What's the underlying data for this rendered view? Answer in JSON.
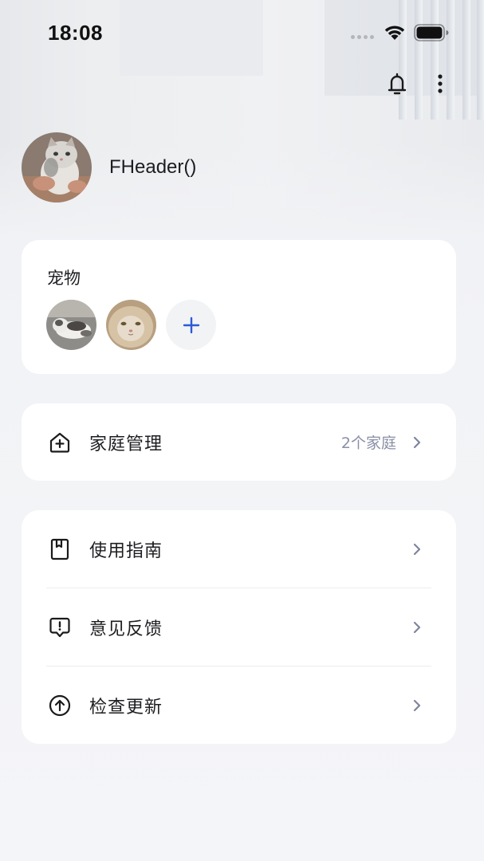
{
  "status_bar": {
    "time": "18:08"
  },
  "header": {
    "notification_icon": "bell-icon",
    "more_icon": "more-vertical-icon"
  },
  "profile": {
    "username": "FHeader()"
  },
  "pets": {
    "title": "宠物",
    "items": [
      "cat-photo-1",
      "cat-photo-2"
    ],
    "add_icon": "plus-icon"
  },
  "family": {
    "label": "家庭管理",
    "value": "2个家庭",
    "icon": "home-add-icon"
  },
  "menu": {
    "items": [
      {
        "label": "使用指南",
        "icon": "guide-book-icon"
      },
      {
        "label": "意见反馈",
        "icon": "feedback-icon"
      },
      {
        "label": "检查更新",
        "icon": "update-arrow-icon"
      }
    ]
  },
  "colors": {
    "accent": "#2b5bd7",
    "muted_text": "#8a90a6",
    "card_bg": "#ffffff",
    "page_bg": "#f2f3f6"
  }
}
